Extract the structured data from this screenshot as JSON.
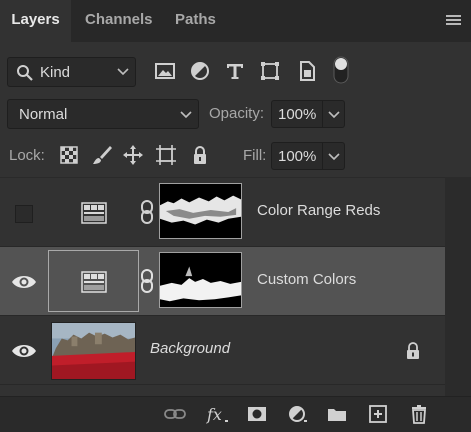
{
  "tabs": [
    {
      "label": "Layers",
      "active": true
    },
    {
      "label": "Channels",
      "active": false
    },
    {
      "label": "Paths",
      "active": false
    }
  ],
  "filter": {
    "kind_label": "Kind",
    "icons": [
      "image-filter-icon",
      "adjustment-filter-icon",
      "type-filter-icon",
      "shape-filter-icon",
      "smart-object-filter-icon"
    ]
  },
  "blend": {
    "mode": "Normal",
    "opacity_label": "Opacity:",
    "opacity_value": "100%"
  },
  "lock": {
    "label": "Lock:",
    "fill_label": "Fill:",
    "fill_value": "100%"
  },
  "layers": [
    {
      "name": "Color Range Reds",
      "visible": false,
      "selected": false,
      "type": "adjustment"
    },
    {
      "name": "Custom Colors",
      "visible": true,
      "selected": true,
      "type": "adjustment"
    },
    {
      "name": "Background",
      "visible": true,
      "selected": false,
      "type": "image",
      "locked": true
    }
  ],
  "bottom_icons": [
    "link-layers-icon",
    "fx-icon",
    "add-mask-icon",
    "new-adjustment-icon",
    "new-group-icon",
    "new-layer-icon",
    "delete-icon"
  ],
  "colors": {
    "panel_bg": "#323232",
    "selected_row": "#535353",
    "tab_bar": "#282828"
  }
}
